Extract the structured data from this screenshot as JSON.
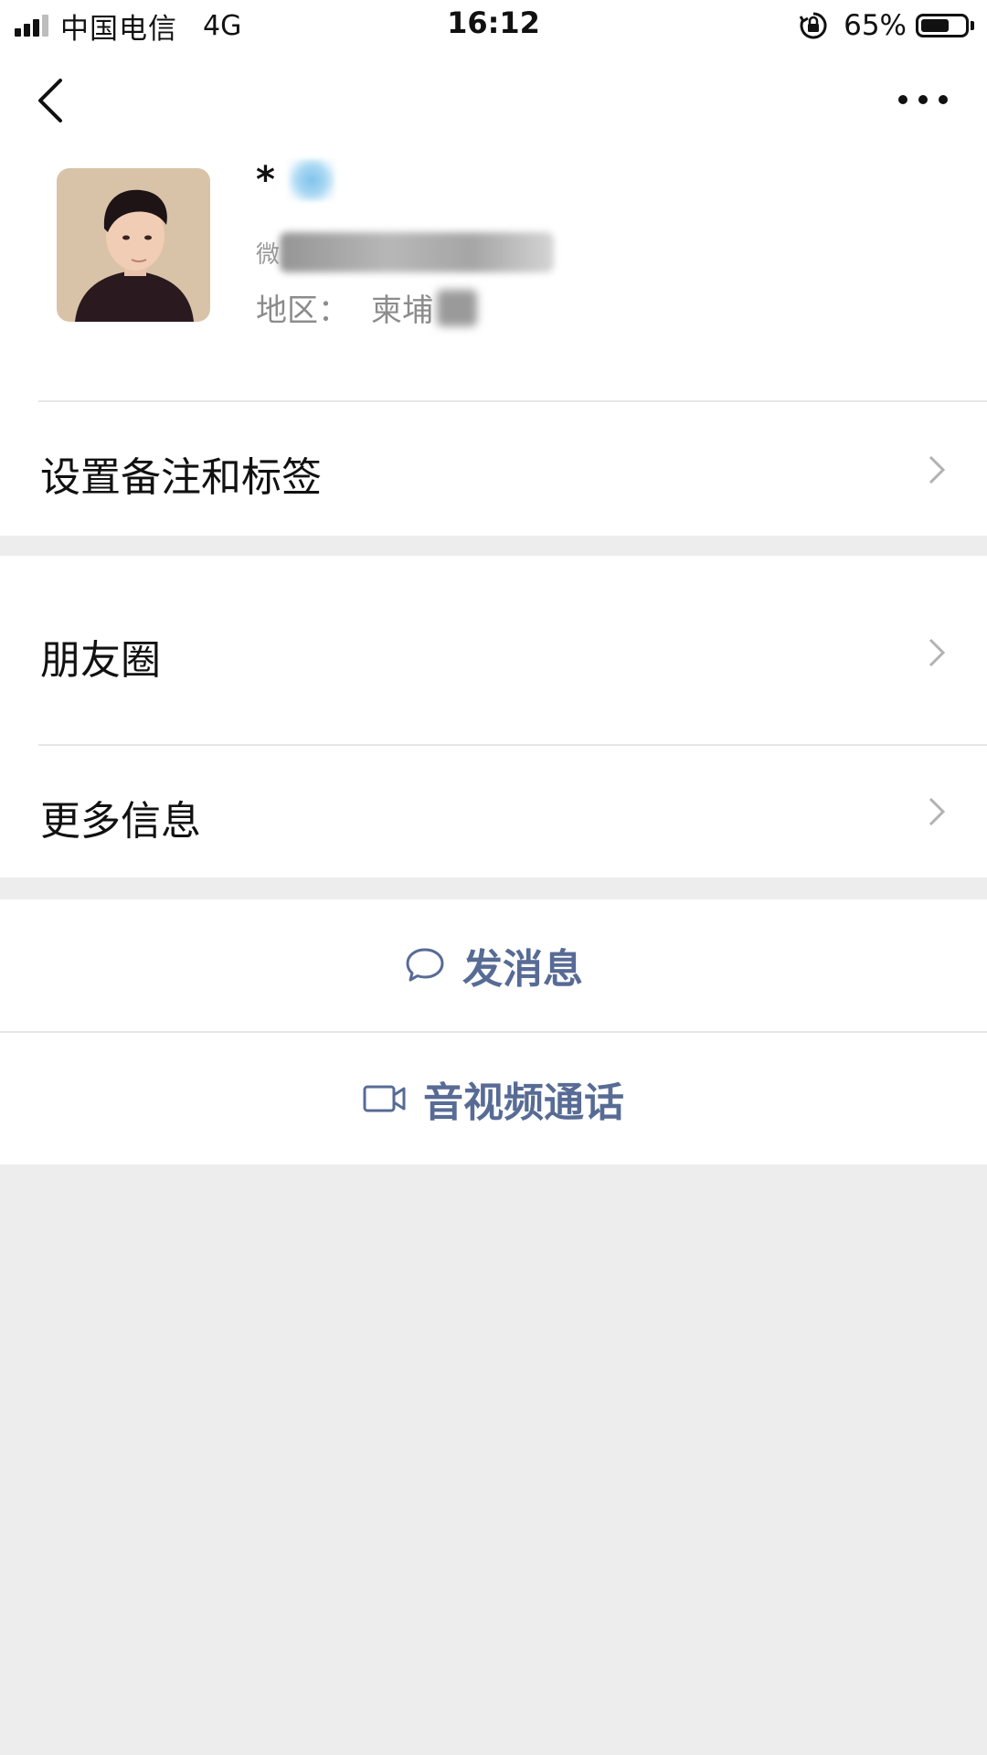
{
  "status_bar": {
    "carrier": "中国电信",
    "network": "4G",
    "time": "16:12",
    "battery_percent": "65%",
    "battery_level": 0.65
  },
  "nav": {
    "back_icon": "chevron-left-icon",
    "more_icon": "more-dots-icon"
  },
  "profile": {
    "name_prefix": "*",
    "wechat_id_label": "微",
    "region_label": "地区：",
    "region_value": "柬埔"
  },
  "menu": {
    "remark_tags": "设置备注和标签",
    "moments": "朋友圈",
    "more_info": "更多信息"
  },
  "actions": {
    "send_message": "发消息",
    "video_call": "音视频通话"
  },
  "colors": {
    "accent": "#576b95",
    "page_bg": "#ededed",
    "card_bg": "#ffffff",
    "divider": "#e6e6e6"
  }
}
